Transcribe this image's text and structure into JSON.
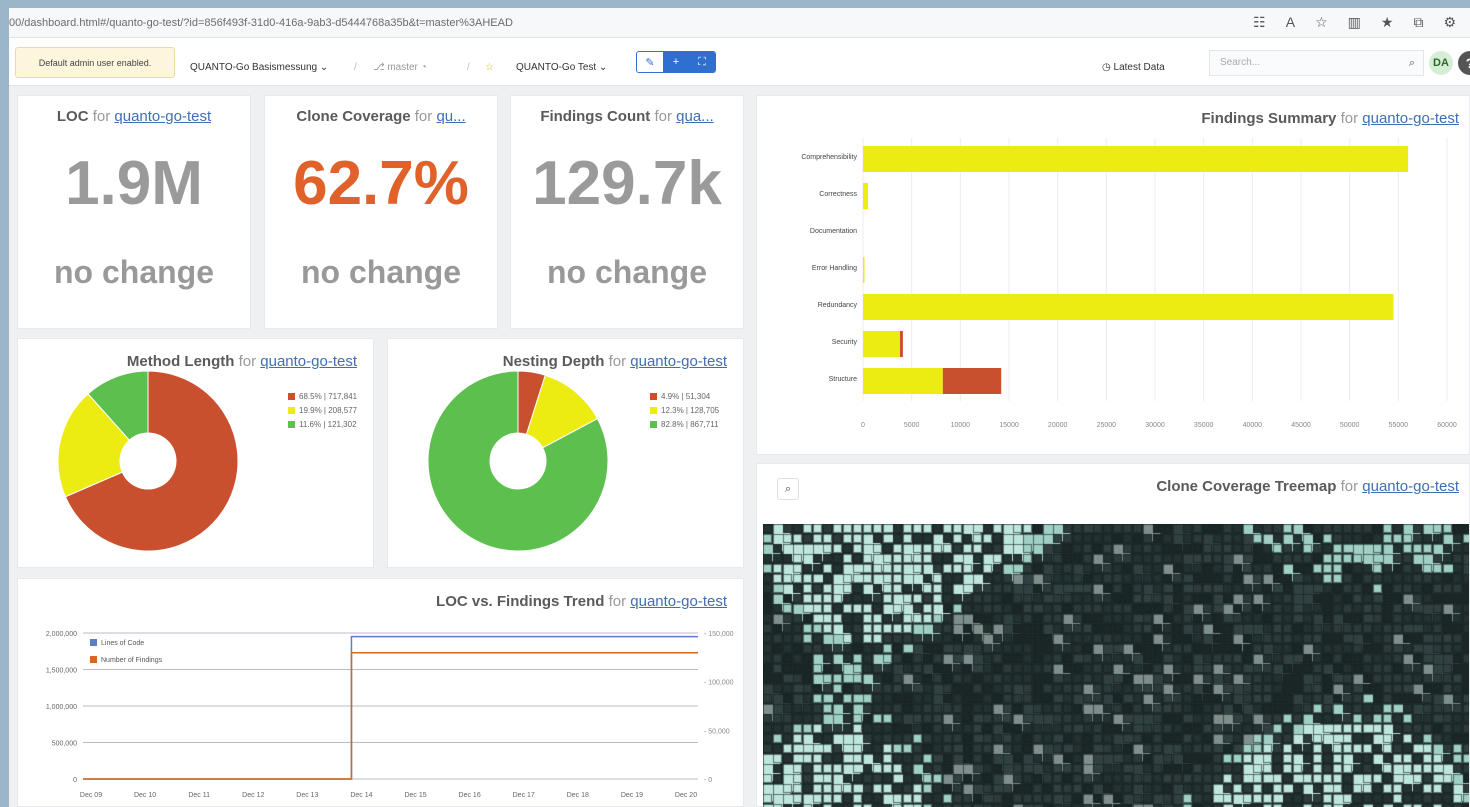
{
  "browser": {
    "url": "00/dashboard.html#/quanto-go-test/?id=856f493f-31d0-416a-9ab3-d5444768a35b&t=master%3AHEAD"
  },
  "toolbar": {
    "admin_notice": "Default admin user enabled.",
    "dashboard_select": "QUANTO-Go Basismessung",
    "branch": "master",
    "project_select": "QUANTO-Go Test",
    "latest_data": "Latest Data",
    "search_placeholder": "Search...",
    "user_initials": "DA",
    "help": "?"
  },
  "widgets": {
    "loc": {
      "metric": "LOC",
      "for": "for",
      "project": "quanto-go-test",
      "value": "1.9M",
      "change": "no change"
    },
    "clone_coverage": {
      "metric": "Clone Coverage",
      "for": "for",
      "project": "qu...",
      "value": "62.7%",
      "change": "no change",
      "color": "#e0622a"
    },
    "findings_count": {
      "metric": "Findings Count",
      "for": "for",
      "project": "qua...",
      "value": "129.7k",
      "change": "no change"
    },
    "method_length": {
      "metric": "Method Length",
      "for": "for",
      "project": "quanto-go-test",
      "legend": [
        "68.5% | 717,841",
        "19.9% | 208,577",
        "11.6% | 121,302"
      ]
    },
    "nesting_depth": {
      "metric": "Nesting Depth",
      "for": "for",
      "project": "quanto-go-test",
      "legend": [
        "4.9% | 51,304",
        "12.3% | 128,705",
        "82.8% | 867,711"
      ]
    },
    "findings_summary": {
      "metric": "Findings Summary",
      "for": "for",
      "project": "quanto-go-test"
    },
    "loc_trend": {
      "metric": "LOC vs. Findings Trend",
      "for": "for",
      "project": "quanto-go-test"
    },
    "treemap": {
      "metric": "Clone Coverage Treemap",
      "for": "for",
      "project": "quanto-go-test"
    }
  },
  "colors": {
    "red": "#c9502f",
    "yellow": "#ecec12",
    "green": "#5cbf4e",
    "blue": "#5b7fc4"
  },
  "chart_data": [
    {
      "type": "pie",
      "title": "Method Length",
      "labels": [
        "68.5% | 717,841",
        "19.9% | 208,577",
        "11.6% | 121,302"
      ],
      "values": [
        68.5,
        19.9,
        11.6
      ],
      "colors": [
        "#c9502f",
        "#ecec12",
        "#5cbf4e"
      ]
    },
    {
      "type": "pie",
      "title": "Nesting Depth",
      "labels": [
        "4.9% | 51,304",
        "12.3% | 128,705",
        "82.8% | 867,711"
      ],
      "values": [
        4.9,
        12.3,
        82.8
      ],
      "colors": [
        "#c9502f",
        "#ecec12",
        "#5cbf4e"
      ]
    },
    {
      "type": "bar",
      "orientation": "horizontal",
      "stacked": true,
      "title": "Findings Summary",
      "categories": [
        "Comprehensibility",
        "Correctness",
        "Documentation",
        "Error Handling",
        "Redundancy",
        "Security",
        "Structure"
      ],
      "series": [
        {
          "values": [
            56000,
            500,
            0,
            150,
            54500,
            3800,
            8200
          ],
          "color": "#ecec12"
        },
        {
          "values": [
            0,
            0,
            0,
            0,
            0,
            300,
            6000
          ],
          "color": "#c9502f"
        }
      ],
      "xlim": [
        0,
        60000
      ],
      "xticks": [
        "0",
        "5000",
        "10000",
        "15000",
        "20000",
        "25000",
        "30000",
        "35000",
        "40000",
        "45000",
        "50000",
        "55000",
        "60000"
      ]
    },
    {
      "type": "line",
      "title": "LOC vs. Findings Trend",
      "x": [
        "Dec 09",
        "Dec 10",
        "Dec 11",
        "Dec 12",
        "Dec 13",
        "Dec 14",
        "Dec 15",
        "Dec 16",
        "Dec 17",
        "Dec 18",
        "Dec 19",
        "Dec 20"
      ],
      "series": [
        {
          "name": "Lines of Code",
          "axis": "left",
          "color": "#5b7fc4",
          "step_at": "Dec 14",
          "before": 0,
          "after": 1950000
        },
        {
          "name": "Number of Findings",
          "axis": "right",
          "color": "#d2691e",
          "step_at": "Dec 14",
          "before": 0,
          "after": 129700
        }
      ],
      "ylim_left": [
        0,
        2000000
      ],
      "ylim_right": [
        0,
        150000
      ],
      "yticks_left": [
        "2,000,000",
        "1,500,000",
        "1,000,000",
        "500,000",
        "0"
      ],
      "yticks_right": [
        "150,000",
        "100,000",
        "50,000",
        "0"
      ]
    }
  ]
}
